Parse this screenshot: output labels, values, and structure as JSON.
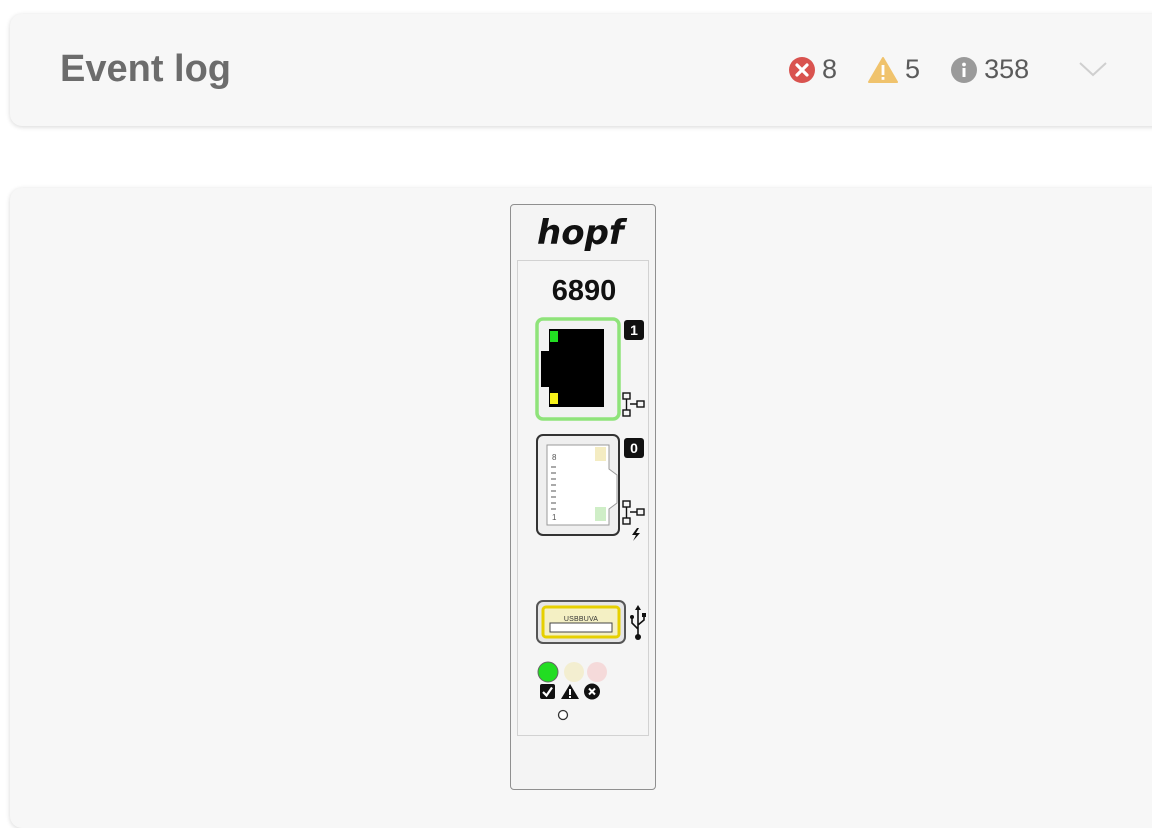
{
  "event_log": {
    "title": "Event log",
    "counters": [
      {
        "type": "error",
        "icon": "error-circle-icon",
        "count": "8",
        "color": "#d9534f"
      },
      {
        "type": "warning",
        "icon": "warning-triangle-icon",
        "count": "5",
        "color": "#f0c36d"
      },
      {
        "type": "info",
        "icon": "info-circle-icon",
        "count": "358",
        "color": "#9a9a9a"
      }
    ],
    "expand_icon": "chevron-down-icon"
  },
  "device": {
    "brand": "hopf",
    "model": "6890",
    "ports": [
      {
        "number": "1",
        "status": "active",
        "accent": "#8fe37a"
      },
      {
        "number": "0",
        "status": "inactive"
      }
    ],
    "port0_pins": {
      "top": "8",
      "bottom": "1"
    },
    "usb_label": "USBBUVA",
    "leds": [
      {
        "name": "ok",
        "color": "#22dd22",
        "lit": true
      },
      {
        "name": "warning",
        "color": "#f3eed0",
        "lit": false
      },
      {
        "name": "error",
        "color": "#f5dada",
        "lit": false
      }
    ]
  }
}
